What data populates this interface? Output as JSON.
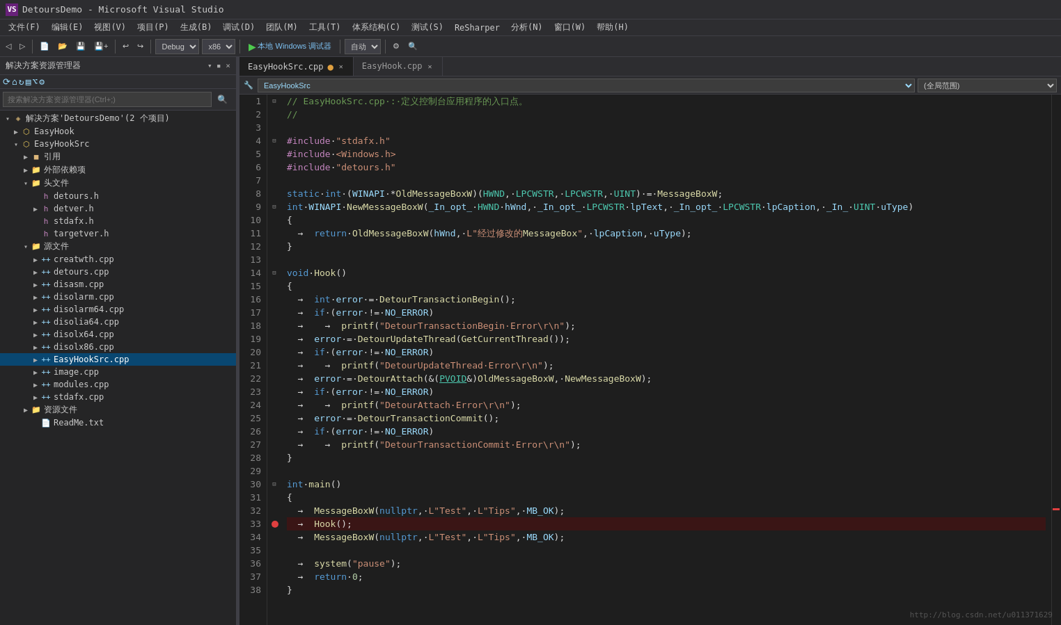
{
  "app": {
    "title": "DetoursDemo - Microsoft Visual Studio",
    "vs_icon": "▶"
  },
  "menu": {
    "items": [
      "文件(F)",
      "编辑(E)",
      "视图(V)",
      "项目(P)",
      "生成(B)",
      "调试(D)",
      "团队(M)",
      "工具(T)",
      "体系结构(C)",
      "测试(S)",
      "ReSharper",
      "分析(N)",
      "窗口(W)",
      "帮助(H)"
    ]
  },
  "toolbar": {
    "debug_config": "Debug",
    "platform": "x86",
    "run_label": "本地 Windows 调试器",
    "attach_label": "自动"
  },
  "solution_explorer": {
    "title": "解决方案资源管理器",
    "search_placeholder": "搜索解决方案资源管理器(Ctrl+;)",
    "solution_label": "解决方案'DetoursDemo'(2 个项目)",
    "tree": [
      {
        "id": "easyhook",
        "label": "EasyHook",
        "indent": 1,
        "type": "project",
        "expanded": false
      },
      {
        "id": "easyhooksrc",
        "label": "EasyHookSrc",
        "indent": 1,
        "type": "project",
        "expanded": true
      },
      {
        "id": "references",
        "label": "引用",
        "indent": 2,
        "type": "folder",
        "expanded": false
      },
      {
        "id": "external-deps",
        "label": "外部依赖项",
        "indent": 2,
        "type": "folder",
        "expanded": false
      },
      {
        "id": "headers",
        "label": "头文件",
        "indent": 2,
        "type": "folder",
        "expanded": true
      },
      {
        "id": "detours-h",
        "label": "detours.h",
        "indent": 3,
        "type": "h"
      },
      {
        "id": "detver-h",
        "label": "detver.h",
        "indent": 3,
        "type": "h",
        "expanded": false
      },
      {
        "id": "stdafx-h",
        "label": "stdafx.h",
        "indent": 3,
        "type": "h"
      },
      {
        "id": "targetver-h",
        "label": "targetver.h",
        "indent": 3,
        "type": "h"
      },
      {
        "id": "sources",
        "label": "源文件",
        "indent": 2,
        "type": "folder",
        "expanded": true
      },
      {
        "id": "creatwth-cpp",
        "label": "creatwth.cpp",
        "indent": 3,
        "type": "cpp"
      },
      {
        "id": "detours-cpp",
        "label": "detours.cpp",
        "indent": 3,
        "type": "cpp"
      },
      {
        "id": "disasm-cpp",
        "label": "disasm.cpp",
        "indent": 3,
        "type": "cpp"
      },
      {
        "id": "disolarm-cpp",
        "label": "disolarm.cpp",
        "indent": 3,
        "type": "cpp"
      },
      {
        "id": "disolarm64-cpp",
        "label": "disolarm64.cpp",
        "indent": 3,
        "type": "cpp"
      },
      {
        "id": "disolia64-cpp",
        "label": "disolia64.cpp",
        "indent": 3,
        "type": "cpp"
      },
      {
        "id": "disolx64-cpp",
        "label": "disolx64.cpp",
        "indent": 3,
        "type": "cpp"
      },
      {
        "id": "disolx86-cpp",
        "label": "disolx86.cpp",
        "indent": 3,
        "type": "cpp"
      },
      {
        "id": "easyhooksrc-cpp",
        "label": "EasyHookSrc.cpp",
        "indent": 3,
        "type": "cpp",
        "selected": true
      },
      {
        "id": "image-cpp",
        "label": "image.cpp",
        "indent": 3,
        "type": "cpp"
      },
      {
        "id": "modules-cpp",
        "label": "modules.cpp",
        "indent": 3,
        "type": "cpp"
      },
      {
        "id": "stdafx-cpp",
        "label": "stdafx.cpp",
        "indent": 3,
        "type": "cpp"
      },
      {
        "id": "resources",
        "label": "资源文件",
        "indent": 2,
        "type": "folder"
      },
      {
        "id": "readme",
        "label": "ReadMe.txt",
        "indent": 3,
        "type": "txt"
      }
    ]
  },
  "tabs": [
    {
      "id": "easyhooksrc-tab",
      "label": "EasyHookSrc.cpp",
      "active": true,
      "modified": true
    },
    {
      "id": "easyhook-tab",
      "label": "EasyHook.cpp",
      "active": false,
      "modified": false
    }
  ],
  "nav_bar": {
    "scope": "EasyHookSrc",
    "scope_right": "(全局范围)"
  },
  "code": {
    "lines": [
      {
        "n": 1,
        "marker": "⊟",
        "text": "// EasyHookSrc.cpp : 定义控制台应用程序的入口点。",
        "type": "comment"
      },
      {
        "n": 2,
        "marker": "",
        "text": "//",
        "type": "comment"
      },
      {
        "n": 3,
        "marker": "",
        "text": "",
        "type": "plain"
      },
      {
        "n": 4,
        "marker": "⊟",
        "text": "#include \"stdafx.h\"",
        "type": "include"
      },
      {
        "n": 5,
        "marker": "",
        "text": "#include <Windows.h>",
        "type": "include"
      },
      {
        "n": 6,
        "marker": "",
        "text": "#include \"detours.h\"",
        "type": "include"
      },
      {
        "n": 7,
        "marker": "",
        "text": "",
        "type": "plain"
      },
      {
        "n": 8,
        "marker": "",
        "text": "static int (WINAPI *OldMessageBoxW)(HWND, LPCWSTR, LPCWSTR, UINT) = MessageBoxW;",
        "type": "code"
      },
      {
        "n": 9,
        "marker": "⊟",
        "text": "int WINAPI NewMessageBoxW(_In_opt_ HWND hWnd, _In_opt_ LPCWSTR lpText, _In_opt_ LPCWSTR lpCaption, _In_ UINT uType)",
        "type": "code"
      },
      {
        "n": 10,
        "marker": "",
        "text": "{",
        "type": "plain"
      },
      {
        "n": 11,
        "marker": "",
        "text": "    → return OldMessageBoxW(hWnd, L\"经过修改的MessageBox\", lpCaption, uType);",
        "type": "code"
      },
      {
        "n": 12,
        "marker": "",
        "text": "}",
        "type": "plain"
      },
      {
        "n": 13,
        "marker": "",
        "text": "",
        "type": "plain"
      },
      {
        "n": 14,
        "marker": "⊟",
        "text": "void Hook()",
        "type": "code"
      },
      {
        "n": 15,
        "marker": "",
        "text": "{",
        "type": "plain"
      },
      {
        "n": 16,
        "marker": "",
        "text": "    → int error = DetourTransactionBegin();",
        "type": "code"
      },
      {
        "n": 17,
        "marker": "",
        "text": "    → if (error != NO_ERROR)",
        "type": "code"
      },
      {
        "n": 18,
        "marker": "",
        "text": "    → → printf(\"DetourTransactionBegin Error\\r\\n\");",
        "type": "code"
      },
      {
        "n": 19,
        "marker": "",
        "text": "    → error = DetourUpdateThread(GetCurrentThread());",
        "type": "code"
      },
      {
        "n": 20,
        "marker": "",
        "text": "    → if (error != NO_ERROR)",
        "type": "code"
      },
      {
        "n": 21,
        "marker": "",
        "text": "    → → printf(\"DetourUpdateThread Error\\r\\n\");",
        "type": "code"
      },
      {
        "n": 22,
        "marker": "",
        "text": "    → error = DetourAttach(&(PVOID&)OldMessageBoxW, NewMessageBoxW);",
        "type": "code"
      },
      {
        "n": 23,
        "marker": "",
        "text": "    → if (error != NO_ERROR)",
        "type": "code"
      },
      {
        "n": 24,
        "marker": "",
        "text": "    → → printf(\"DetourAttach Error\\r\\n\");",
        "type": "code"
      },
      {
        "n": 25,
        "marker": "",
        "text": "    → error = DetourTransactionCommit();",
        "type": "code"
      },
      {
        "n": 26,
        "marker": "",
        "text": "    → if (error != NO_ERROR)",
        "type": "code"
      },
      {
        "n": 27,
        "marker": "",
        "text": "    → → printf(\"DetourTransactionCommit Error\\r\\n\");",
        "type": "code"
      },
      {
        "n": 28,
        "marker": "",
        "text": "}",
        "type": "plain"
      },
      {
        "n": 29,
        "marker": "",
        "text": "",
        "type": "plain"
      },
      {
        "n": 30,
        "marker": "⊟",
        "text": "int main()",
        "type": "code"
      },
      {
        "n": 31,
        "marker": "",
        "text": "{",
        "type": "plain"
      },
      {
        "n": 32,
        "marker": "",
        "text": "    → MessageBoxW(nullptr, L\"Test\", L\"Tips\", MB_OK);",
        "type": "code",
        "breakpoint": false
      },
      {
        "n": 33,
        "marker": "",
        "text": "    → Hook();",
        "type": "code",
        "breakpoint": true
      },
      {
        "n": 34,
        "marker": "",
        "text": "    → MessageBoxW(nullptr, L\"Test\", L\"Tips\", MB_OK);",
        "type": "code"
      },
      {
        "n": 35,
        "marker": "",
        "text": "",
        "type": "plain"
      },
      {
        "n": 36,
        "marker": "",
        "text": "    → system(\"pause\");",
        "type": "code"
      },
      {
        "n": 37,
        "marker": "",
        "text": "    → return 0;",
        "type": "code"
      },
      {
        "n": 38,
        "marker": "",
        "text": "}",
        "type": "plain"
      }
    ]
  },
  "watermark": "http://blog.csdn.net/u011371629"
}
